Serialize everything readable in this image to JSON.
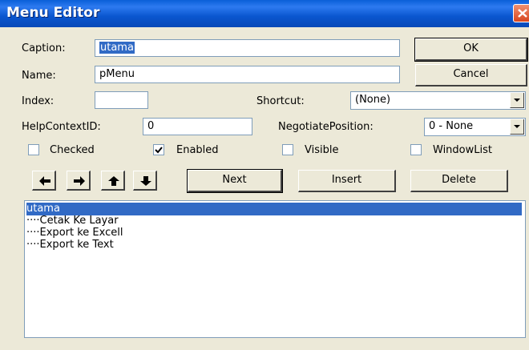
{
  "window": {
    "title": "Menu Editor"
  },
  "caption": {
    "label": "Caption:",
    "value": "utama"
  },
  "name": {
    "label": "Name:",
    "value": "pMenu"
  },
  "index": {
    "label": "Index:",
    "value": ""
  },
  "shortcut": {
    "label": "Shortcut:",
    "value": "(None)"
  },
  "help": {
    "label": "HelpContextID:",
    "value": "0"
  },
  "negotiate": {
    "label": "NegotiatePosition:",
    "value": "0 - None"
  },
  "checkboxes": [
    {
      "label": "Checked",
      "checked": false
    },
    {
      "label": "Enabled",
      "checked": true
    },
    {
      "label": "Visible",
      "checked": false
    },
    {
      "label": "WindowList",
      "checked": false
    }
  ],
  "buttons": {
    "ok": "OK",
    "cancel": "Cancel",
    "next": "Next",
    "insert": "Insert",
    "delete": "Delete"
  },
  "arrows": [
    "left-arrow-icon",
    "right-arrow-icon",
    "up-arrow-icon",
    "down-arrow-icon"
  ],
  "menu_items": [
    {
      "text": "utama",
      "selected": true
    },
    {
      "text": "····Cetak Ke Layar",
      "selected": false
    },
    {
      "text": "····Export ke Excell",
      "selected": false
    },
    {
      "text": "····Export ke Text",
      "selected": false
    }
  ],
  "colors": {
    "titlebar": "#0a56cf",
    "selection": "#316ac5",
    "face": "#ece9d8"
  }
}
